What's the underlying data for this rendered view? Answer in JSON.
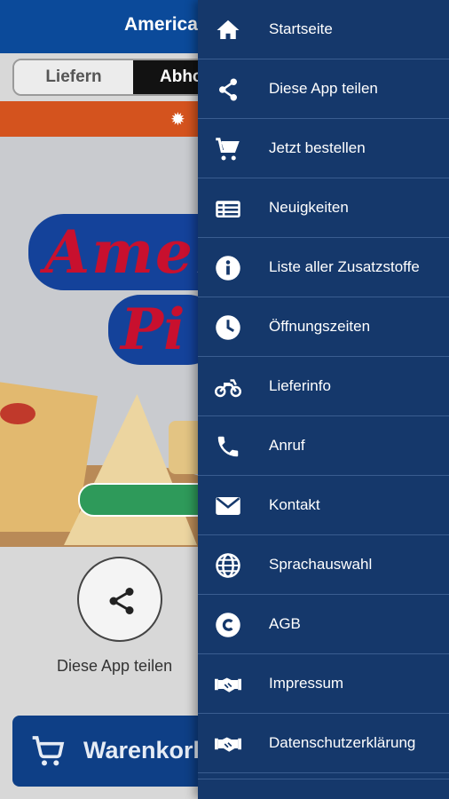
{
  "app": {
    "title": "American",
    "delivery_toggle": {
      "option1": "Liefern",
      "option2": "Abho"
    },
    "logo": {
      "line1_a": "Ame",
      "line1_b": "r",
      "line2_a": "Pi",
      "line2_b": ""
    },
    "share": {
      "label": "Diese App teilen",
      "icon": "share-icon"
    },
    "cart": {
      "label": "Warenkorb",
      "icon": "cart-icon"
    }
  },
  "drawer": {
    "items": [
      {
        "label": "Startseite",
        "icon": "home-icon"
      },
      {
        "label": "Diese App teilen",
        "icon": "share-icon"
      },
      {
        "label": "Jetzt bestellen",
        "icon": "cart-icon"
      },
      {
        "label": "Neuigkeiten",
        "icon": "news-icon"
      },
      {
        "label": "Liste aller Zusatzstoffe",
        "icon": "info-icon"
      },
      {
        "label": "Öffnungszeiten",
        "icon": "clock-icon"
      },
      {
        "label": "Lieferinfo",
        "icon": "motorbike-icon"
      },
      {
        "label": "Anruf",
        "icon": "phone-icon"
      },
      {
        "label": "Kontakt",
        "icon": "mail-icon"
      },
      {
        "label": "Sprachauswahl",
        "icon": "globe-icon"
      },
      {
        "label": "AGB",
        "icon": "copyright-icon"
      },
      {
        "label": "Impressum",
        "icon": "handshake-icon"
      },
      {
        "label": "Datenschutzerklärung",
        "icon": "handshake-icon"
      }
    ]
  },
  "colors": {
    "drawer_bg": "#15386b",
    "topbar": "#0b4a9a",
    "orange_banner": "#d4531e",
    "accent_red": "#c8102e"
  }
}
